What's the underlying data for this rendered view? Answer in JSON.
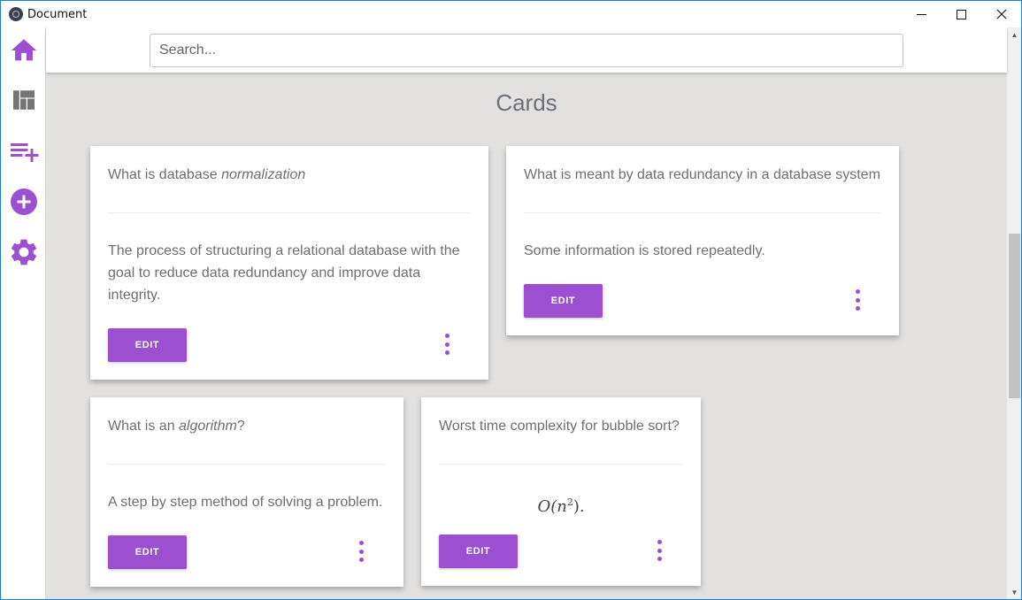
{
  "window": {
    "title": "Document",
    "controls": {
      "minimize_icon": "minimize-icon",
      "maximize_icon": "maximize-icon",
      "close_icon": "close-icon"
    }
  },
  "sidebar": {
    "items": [
      {
        "icon": "home-icon",
        "name": "home"
      },
      {
        "icon": "dashboard-icon",
        "name": "dashboard"
      },
      {
        "icon": "playlist-add-icon",
        "name": "playlist-add"
      },
      {
        "icon": "add-circle-icon",
        "name": "add"
      },
      {
        "icon": "gear-icon",
        "name": "settings"
      }
    ],
    "accent": "#9c4fd1",
    "muted": "#757575"
  },
  "search": {
    "placeholder": "Search...",
    "value": ""
  },
  "main": {
    "title": "Cards",
    "background": "#e2e1e0",
    "cards": [
      {
        "question_prefix": "What is database ",
        "question_em": "normalization",
        "question_suffix": "",
        "answer": "The process of structuring a relational database with the goal to reduce data redundancy and improve data integrity.",
        "edit_label": "EDIT"
      },
      {
        "question_prefix": "What is meant by data redundancy in a database system",
        "question_em": "",
        "question_suffix": "",
        "answer": "Some information is stored repeatedly.",
        "edit_label": "EDIT"
      },
      {
        "question_prefix": "What is an ",
        "question_em": "algorithm",
        "question_suffix": "?",
        "answer": "A step by step method of solving a problem.",
        "edit_label": "EDIT"
      },
      {
        "question_prefix": "Worst time complexity for bubble sort?",
        "question_em": "",
        "question_suffix": "",
        "answer_math_base": "O(n",
        "answer_math_exp": "2",
        "answer_math_tail": ").",
        "edit_label": "EDIT"
      }
    ]
  },
  "colors": {
    "accent": "#9c4fd1",
    "window_border": "#1b7fd6"
  }
}
